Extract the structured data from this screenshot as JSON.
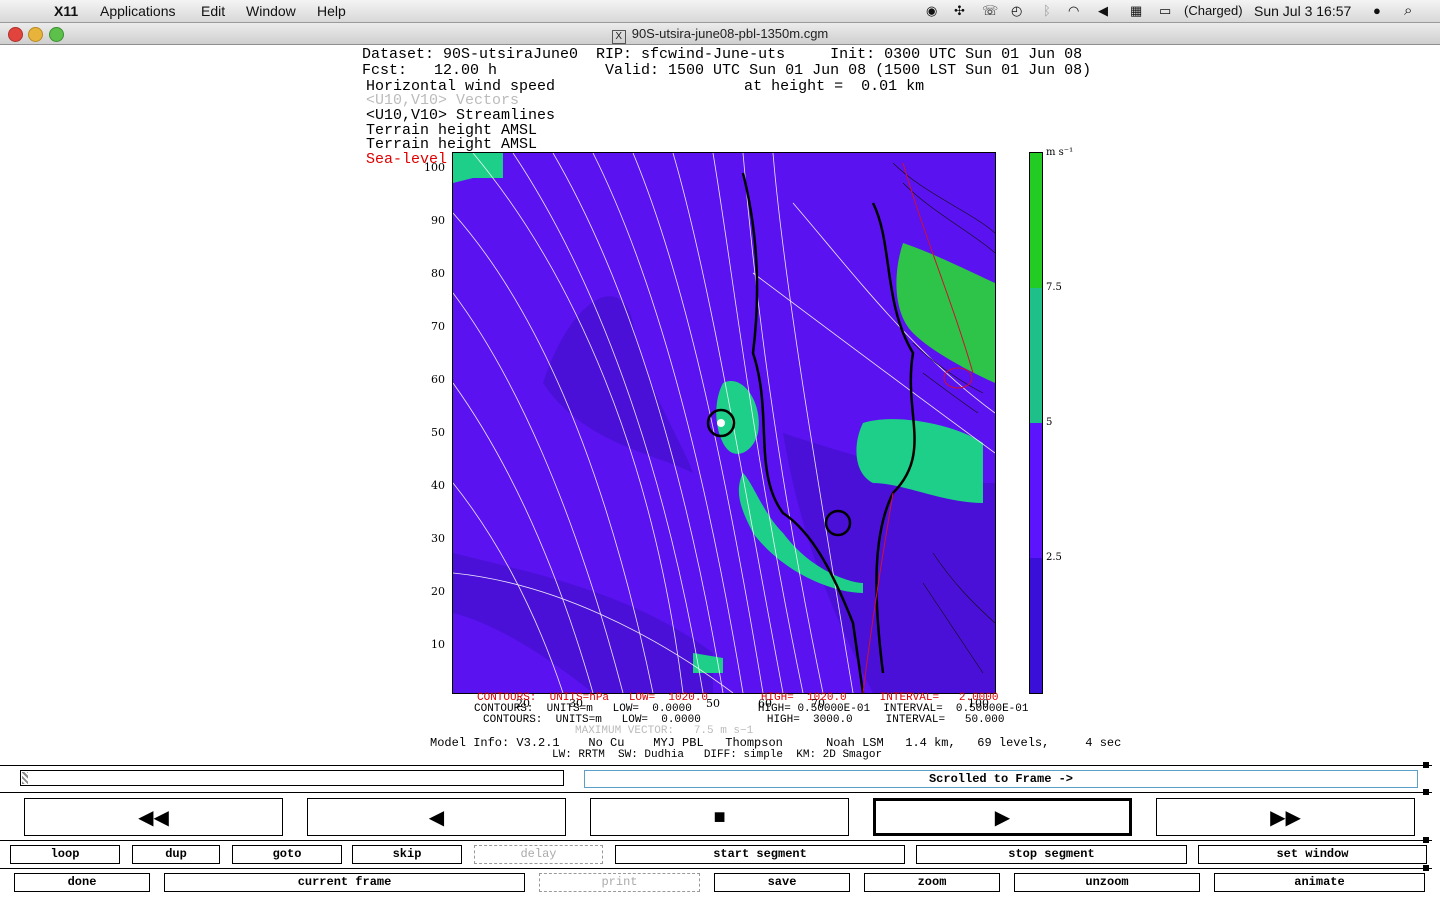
{
  "menubar": {
    "app": "X11",
    "items": [
      "Applications",
      "Edit",
      "Window",
      "Help"
    ],
    "battery": "(Charged)",
    "clock": "Sun Jul 3  16:57"
  },
  "window": {
    "title": "90S-utsira-june08-pbl-1350m.cgm"
  },
  "plot_header": {
    "line1": "Dataset: 90S-utsiraJune0  RIP: sfcwind-June-uts     Init: 0300 UTC Sun 01 Jun 08",
    "line2": "Fcst:   12.00 h            Valid: 1500 UTC Sun 01 Jun 08 (1500 LST Sun 01 Jun 08)",
    "line3": "Horizontal wind speed                     at height =  0.01 km",
    "line4": "<U10,V10> Vectors",
    "line5": "<U10,V10> Streamlines",
    "line6": "Terrain height AMSL",
    "line7": "Terrain height AMSL",
    "line8": "Sea-level pressure"
  },
  "axes": {
    "y_ticks": [
      "100",
      "90",
      "80",
      "70",
      "60",
      "50",
      "40",
      "30",
      "20",
      "10"
    ],
    "x_ticks": [
      "10",
      "20",
      "30",
      "40",
      "50",
      "60",
      "70",
      "80",
      "90",
      "100"
    ]
  },
  "colorbar": {
    "unit": "m s⁻¹",
    "labels": [
      "7.5",
      "5",
      "2.5"
    ],
    "colors": [
      "#22cc22",
      "#1fbf8a",
      "#5c14ff",
      "#3a10d8"
    ]
  },
  "plot_colors": {
    "background": "#5a12f0",
    "dark": "#4010c8",
    "teal": "#1ecf8a",
    "green": "#2ec44a"
  },
  "footer": {
    "contours1": "CONTOURS:  UNITS=hPa   LOW=  1020.0        HIGH=  1020.0     INTERVAL=   2.0000",
    "contours2": "CONTOURS:  UNITS=m   LOW=  0.0000          HIGH= 0.50000E-01  INTERVAL=  0.50000E-01",
    "contours3": "CONTOURS:  UNITS=m   LOW=  0.0000          HIGH=  3000.0     INTERVAL=   50.000",
    "maxvec": "MAXIMUM VECTOR:   7.5 m s−1",
    "model1": "Model Info: V3.2.1    No Cu    MYJ PBL   Thompson      Noah LSM   1.4 km,   69 levels,     4 sec",
    "model2": "LW: RRTM  SW: Dudhia   DIFF: simple  KM: 2D Smagor"
  },
  "controls": {
    "frame_status": "Scrolled to Frame ->",
    "transport": [
      "rewind-fast",
      "step-back",
      "stop",
      "play",
      "fast-forward"
    ],
    "row1": [
      "loop",
      "dup",
      "goto",
      "skip",
      "delay",
      "start segment",
      "stop segment",
      "set window"
    ],
    "row2": [
      "done",
      "current frame",
      "print",
      "save",
      "zoom",
      "unzoom",
      "animate"
    ],
    "disabled": [
      "delay",
      "print"
    ]
  }
}
